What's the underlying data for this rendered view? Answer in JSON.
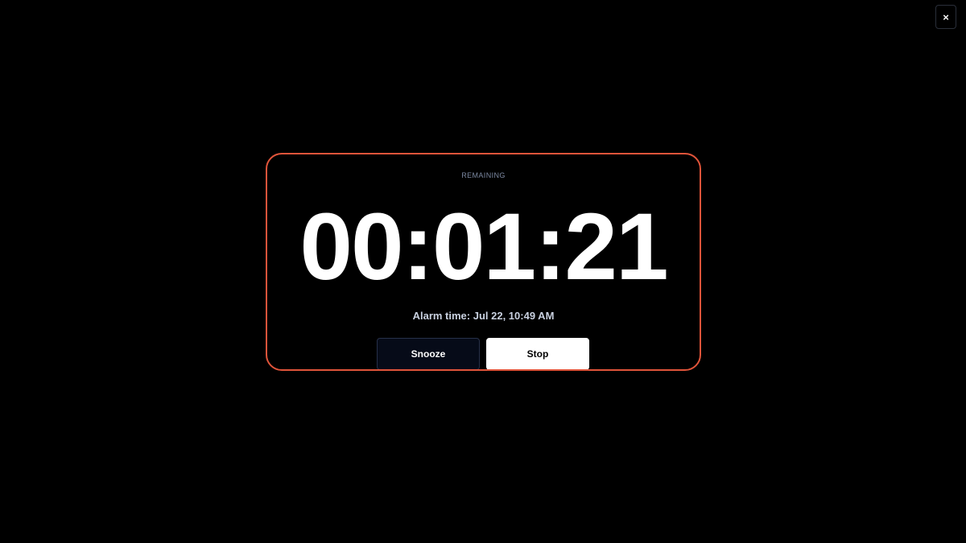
{
  "close": {
    "label": "×",
    "icon": "close-icon"
  },
  "alarm": {
    "remaining_label": "REMAINING",
    "countdown": "00:01:21",
    "alarm_time": "Alarm time: Jul 22, 10:49 AM"
  },
  "actions": {
    "snooze_label": "Snooze",
    "stop_label": "Stop"
  },
  "colors": {
    "background": "#000000",
    "accent_border": "#e0543a",
    "snooze_bg": "#060b18",
    "stop_bg": "#ffffff"
  }
}
